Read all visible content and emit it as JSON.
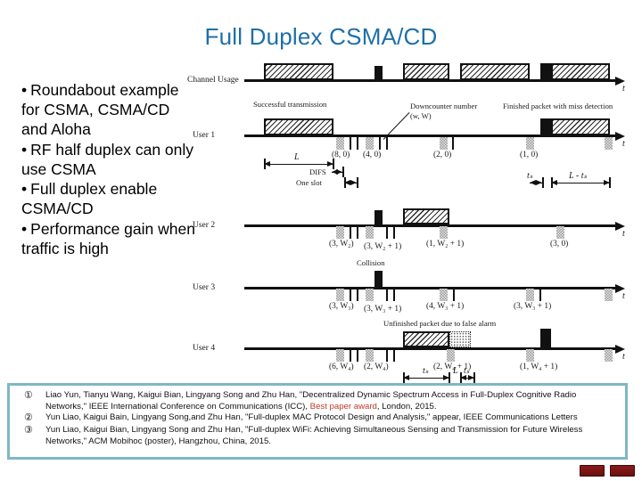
{
  "slide": {
    "title": "Full Duplex CSMA/CD",
    "title_color": "#1f6fa8"
  },
  "bullets": [
    "Roundabout example for CSMA, CSMA/CD and Aloha",
    "RF half duplex can only use CSMA",
    "Full duplex enable CSMA/CD",
    "Performance gain when traffic is high"
  ],
  "bullet_marker": "•",
  "diagram": {
    "row_labels": {
      "channel": "Channel Usage",
      "user1": "User 1",
      "user2": "User 2",
      "user3": "User 3",
      "user4": "User 4"
    },
    "axis_label": "t",
    "annotations": {
      "successful": "Successful transmission",
      "downcounter": "Downcounter number",
      "downcounter_pair": "(w, W)",
      "miss_detection": "Finished packet with miss detection",
      "collision": "Collision",
      "false_alarm": "Unfinished packet due to false alarm"
    },
    "measures": {
      "L": "L",
      "difs": "DIFS",
      "one_slot": "One slot",
      "ts": "tₛ",
      "L_minus_ts": "L - tₛ",
      "ts2": "tₛ",
      "L2": "L",
      "ts3": "tₛ"
    },
    "user1_pairs": [
      "(8, 0)",
      "(4, 0)",
      "(2, 0)",
      "(1, 0)"
    ],
    "user2_pairs": [
      "(3, W₂)",
      "(3, W₂ + 1)",
      "(1, W₂ + 1)",
      "(3, 0)"
    ],
    "user3_pairs": [
      "(3, W₃)",
      "(3, W₃ + 1)",
      "(4, W₃ + 1)",
      "(3, W₃ + 1)"
    ],
    "user4_pairs": [
      "(6, W₄)",
      "(2, W₄)",
      "(2, W₄ + 1)",
      "(1, W₄ + 1)"
    ]
  },
  "references": [
    {
      "num": "①",
      "pre": "Liao Yun, Tianyu Wang, Kaigui Bian, Lingyang Song and Zhu Han, \"Decentralized Dynamic Spectrum Access in Full-Duplex Cognitive Radio Networks,\" IEEE International Conference on Communications (ICC), ",
      "highlight": "Best paper award",
      "post": ", London,  2015."
    },
    {
      "num": "②",
      "pre": "Yun Liao, Kaigui Bain, Lingyang Song,and Zhu Han, \"Full-duplex MAC Protocol Design and Analysis,\" appear, IEEE Communications Letters",
      "highlight": "",
      "post": ""
    },
    {
      "num": "③",
      "pre": "Yun Liao, Kaigui Bian, Lingyang Song and Zhu Han, \"Full-duplex WiFi: Achieving Simultaneous Sensing and Transmission for Future Wireless Networks,\" ACM Mobihoc (poster), Hangzhou, China, 2015.",
      "highlight": "",
      "post": ""
    }
  ],
  "colors": {
    "accent": "#1f6fa8",
    "ref_border": "#7fb7c6",
    "highlight": "#c0392b"
  }
}
